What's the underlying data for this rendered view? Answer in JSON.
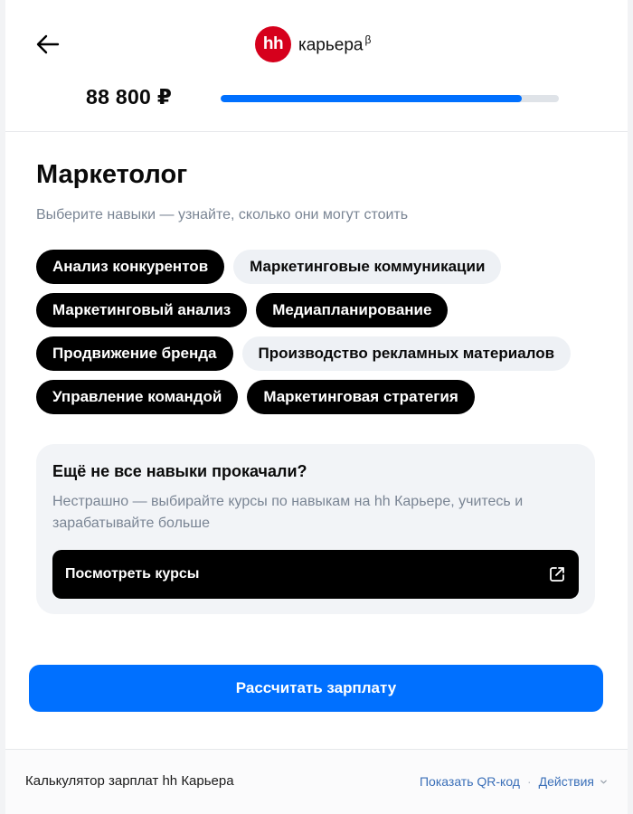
{
  "header": {
    "logo_mark": "hh",
    "logo_text": "карьера",
    "logo_sup": "β",
    "salary": "88 800 ₽",
    "progress_fraction": 0.89,
    "accent_color": "#0070ff"
  },
  "main": {
    "title": "Маркетолог",
    "subtitle": "Выберите навыки — узнайте, сколько они могут стоить",
    "skills": [
      {
        "label": "Анализ конкурентов",
        "selected": true
      },
      {
        "label": "Маркетинговые коммуникации",
        "selected": false
      },
      {
        "label": "Маркетинговый анализ",
        "selected": true
      },
      {
        "label": "Медиапланирование",
        "selected": true
      },
      {
        "label": "Продвижение бренда",
        "selected": true
      },
      {
        "label": "Производство рекламных материалов",
        "selected": false
      },
      {
        "label": "Управление командой",
        "selected": true
      },
      {
        "label": "Маркетинговая стратегия",
        "selected": true
      }
    ],
    "promo": {
      "title": "Ещё не все навыки прокачали?",
      "text": "Нестрашно — выбирайте курсы по навыкам на hh Карьере, учитесь и зарабатывайте больше",
      "button_label": "Посмотреть курсы",
      "button_icon": "external-link-icon"
    },
    "calc_button_label": "Рассчитать зарплату"
  },
  "footer": {
    "title": "Калькулятор зарплат hh Карьера",
    "qr_link": "Показать QR-код",
    "actions_link": "Действия"
  }
}
